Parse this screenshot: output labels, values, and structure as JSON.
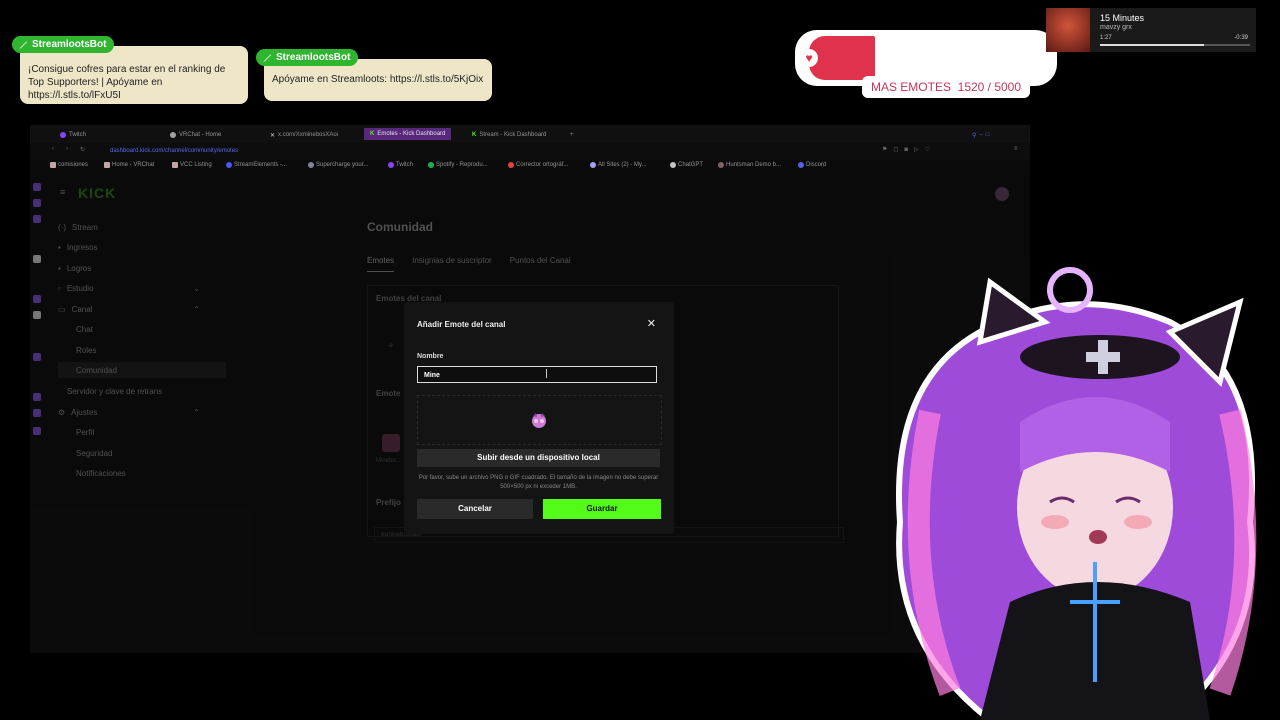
{
  "chat_messages": [
    {
      "user": "StreamlootsBot",
      "text": "¡Consigue cofres para estar en el ranking de Top Supporters! | Apóyame en https://l.stls.to/lFxU5I"
    },
    {
      "user": "StreamlootsBot",
      "text": "Apóyame en Streamloots: https://l.stls.to/5KjOix"
    }
  ],
  "emote_goal": {
    "label": "MAS EMOTES",
    "current": 1520,
    "target": 5000,
    "progress_text": "1520 / 5000",
    "color": "#e0324c"
  },
  "music": {
    "title": "15 Minutes",
    "artist": "mavzy grx",
    "elapsed": "1:27",
    "remaining": "-0:39",
    "progress": 0.69
  },
  "browser": {
    "tabs": [
      {
        "label": "Twitch",
        "icon": "twitch-icon"
      },
      {
        "label": "VRChat - Home",
        "icon": "vrchat-icon"
      },
      {
        "label": "x.com/XxminebosXAoi",
        "icon": "x-icon"
      },
      {
        "label": "Emotes - Kick Dashboard",
        "icon": "kick-icon",
        "active": true
      },
      {
        "label": "Stream - Kick Dashboard",
        "icon": "kick-icon"
      }
    ],
    "url": "dashboard.kick.com/channel/community/emotes",
    "bookmarks": [
      "comisiones",
      "Home - VRChat",
      "VCC Listing",
      "StreamElements -...",
      "Supercharge your...",
      "Twitch",
      "Spotify - Reprodu...",
      "Corrector ortográf...",
      "All Sites (2) - My...",
      "ChatGPT",
      "Huntsman Demo b...",
      "Discord"
    ]
  },
  "kick": {
    "logo": "KICK",
    "nav": [
      {
        "label": "Stream",
        "icon": "stream-icon"
      },
      {
        "label": "Ingresos",
        "icon": "income-icon"
      },
      {
        "label": "Logros",
        "icon": "trophy-icon"
      },
      {
        "label": "Estudio",
        "icon": "studio-icon"
      },
      {
        "label": "Canal",
        "icon": "channel-icon"
      },
      {
        "label": "Chat"
      },
      {
        "label": "Roles"
      },
      {
        "label": "Comunidad",
        "selected": true
      },
      {
        "label": "Servidor y clave de retrans"
      },
      {
        "label": "Ajustes",
        "icon": "settings-icon"
      },
      {
        "label": "Perfil"
      },
      {
        "label": "Seguridad"
      },
      {
        "label": "Notificaciones"
      }
    ],
    "page_title": "Comunidad",
    "tabs": [
      "Emotes",
      "Insignias de suscriptor",
      "Puntos del Canal"
    ],
    "section_channel_emotes": "Emotes del canal",
    "section_emotes_sub": "Emote",
    "emote_name": "Minebo...",
    "prefix_label": "Prefijo",
    "prefix_value": "xxmineboxxaoi"
  },
  "modal": {
    "title": "Añadir Emote del canal",
    "name_label": "Nombre",
    "name_value": "Mine",
    "upload_button": "Subir desde un dispositivo local",
    "hint": "Por favor, sube un archivo PNG o GIF cuadrado. El tamaño de la imagen no debe superar 500×500 px ni exceder 1MB.",
    "cancel": "Cancelar",
    "save": "Guardar"
  }
}
